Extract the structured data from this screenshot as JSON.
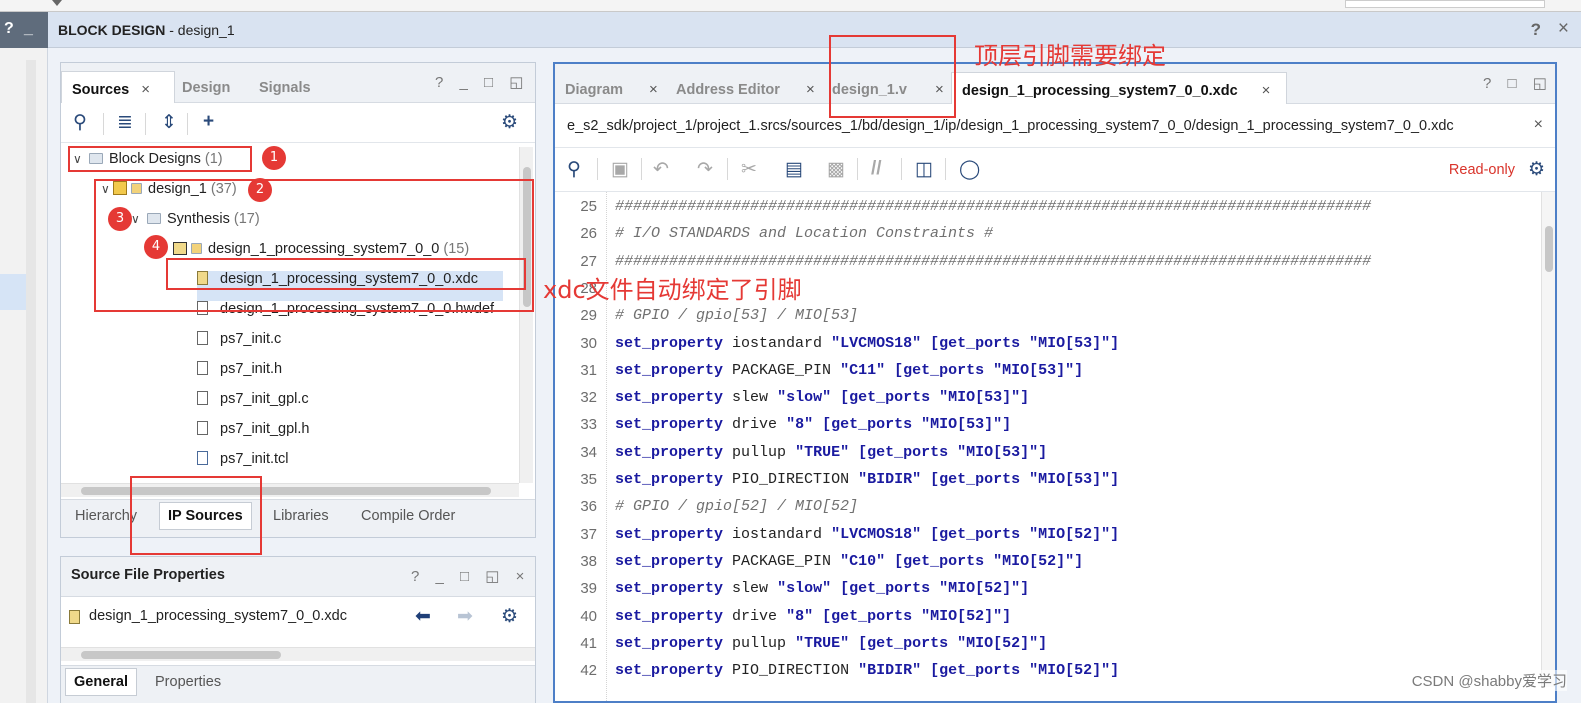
{
  "left_strip": {
    "help": "?",
    "min": "_"
  },
  "header": {
    "label": "BLOCK DESIGN",
    "title": " - design_1",
    "help": "?",
    "close": "×"
  },
  "sources_panel": {
    "tabs": [
      {
        "label": "Sources",
        "close": "×"
      },
      {
        "label": "Design"
      },
      {
        "label": "Signals"
      }
    ],
    "tools": "? _ □ ◱",
    "tree": [
      {
        "label": "Block Designs",
        "count": "(1)"
      },
      {
        "label": "design_1",
        "count": "(37)"
      },
      {
        "label": "Synthesis",
        "count": "(17)"
      },
      {
        "label": "design_1_processing_system7_0_0",
        "count": "(15)"
      },
      {
        "label": "design_1_processing_system7_0_0.xdc",
        "count": ""
      },
      {
        "label": "design_1_processing_system7_0_0.hwdef",
        "count": ""
      },
      {
        "label": "ps7_init.c",
        "count": ""
      },
      {
        "label": "ps7_init.h",
        "count": ""
      },
      {
        "label": "ps7_init_gpl.c",
        "count": ""
      },
      {
        "label": "ps7_init_gpl.h",
        "count": ""
      },
      {
        "label": "ps7_init.tcl",
        "count": ""
      }
    ],
    "subtabs": [
      "Hierarchy",
      "IP Sources",
      "Libraries",
      "Compile Order"
    ]
  },
  "props_panel": {
    "title": "Source File Properties",
    "tools": "? _ □ ◱ ×",
    "file": "design_1_processing_system7_0_0.xdc",
    "subtabs": [
      "General",
      "Properties"
    ]
  },
  "editor": {
    "tabs": [
      {
        "label": "Diagram",
        "close": "×"
      },
      {
        "label": "Address Editor",
        "close": "×"
      },
      {
        "label": "design_1.v",
        "close": "×"
      },
      {
        "label": "design_1_processing_system7_0_0.xdc",
        "close": "×"
      }
    ],
    "tools": "? □ ◱",
    "path": "e_s2_sdk/project_1/project_1.srcs/sources_1/bd/design_1/ip/design_1_processing_system7_0_0/design_1_processing_system7_0_0.xdc",
    "path_close": "×",
    "readonly": "Read-only",
    "lines": [
      {
        "n": "25",
        "kind": "comment",
        "text": "####################################################################################"
      },
      {
        "n": "26",
        "kind": "comment",
        "text": "# I/O STANDARDS and Location Constraints                                            #"
      },
      {
        "n": "27",
        "kind": "comment",
        "text": "####################################################################################"
      },
      {
        "n": "28",
        "kind": "blank",
        "text": ""
      },
      {
        "n": "29",
        "kind": "comment",
        "text": "#  GPIO / gpio[53] / MIO[53]"
      },
      {
        "n": "30",
        "kind": "prop",
        "prop": "iostandard",
        "val": "\"LVCMOS18\"",
        "port": "\"MIO[53]\""
      },
      {
        "n": "31",
        "kind": "prop",
        "prop": "PACKAGE_PIN",
        "val": "\"C11\"",
        "port": "\"MIO[53]\""
      },
      {
        "n": "32",
        "kind": "prop",
        "prop": "slew",
        "val": "\"slow\"",
        "port": "\"MIO[53]\""
      },
      {
        "n": "33",
        "kind": "prop",
        "prop": "drive",
        "val": "\"8\"",
        "port": "\"MIO[53]\""
      },
      {
        "n": "34",
        "kind": "prop",
        "prop": "pullup",
        "val": "\"TRUE\"",
        "port": "\"MIO[53]\""
      },
      {
        "n": "35",
        "kind": "prop",
        "prop": "PIO_DIRECTION",
        "val": "\"BIDIR\"",
        "port": "\"MIO[53]\""
      },
      {
        "n": "36",
        "kind": "comment",
        "text": "#  GPIO / gpio[52] / MIO[52]"
      },
      {
        "n": "37",
        "kind": "prop",
        "prop": "iostandard",
        "val": "\"LVCMOS18\"",
        "port": "\"MIO[52]\""
      },
      {
        "n": "38",
        "kind": "prop",
        "prop": "PACKAGE_PIN",
        "val": "\"C10\"",
        "port": "\"MIO[52]\""
      },
      {
        "n": "39",
        "kind": "prop",
        "prop": "slew",
        "val": "\"slow\"",
        "port": "\"MIO[52]\""
      },
      {
        "n": "40",
        "kind": "prop",
        "prop": "drive",
        "val": "\"8\"",
        "port": "\"MIO[52]\""
      },
      {
        "n": "41",
        "kind": "prop",
        "prop": "pullup",
        "val": "\"TRUE\"",
        "port": "\"MIO[52]\""
      },
      {
        "n": "42",
        "kind": "prop",
        "prop": "PIO_DIRECTION",
        "val": "\"BIDIR\"",
        "port": "\"MIO[52]\""
      }
    ],
    "kw_set": "set_property",
    "kw_get": "[get_ports",
    "kw_end": "]"
  },
  "annotations": {
    "top_label": "顶层引脚需要绑定",
    "mid_label": "xdc文件自动绑定了引脚",
    "badges": [
      "1",
      "2",
      "3",
      "4"
    ]
  },
  "watermark": "CSDN @shabby爱学习",
  "colors": {
    "annotation": "#e53935",
    "keyword": "#1a1aa0",
    "header": "#d9e3f1",
    "selection": "#d6e4f6"
  }
}
